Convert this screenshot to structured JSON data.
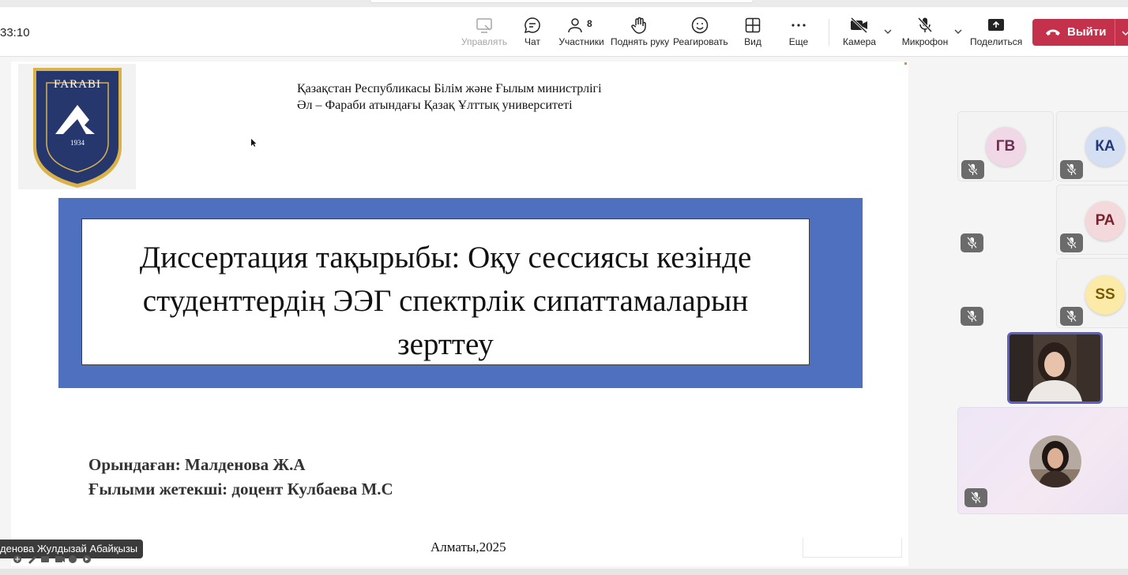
{
  "meeting": {
    "timer": "33:10",
    "participants_count": "8"
  },
  "toolbar": {
    "manage": "Управлять",
    "chat": "Чат",
    "participants": "Участники",
    "raise_hand": "Поднять руку",
    "react": "Реагировать",
    "view": "Вид",
    "more": "Еще",
    "camera": "Камера",
    "microphone": "Микрофон",
    "share": "Поделиться",
    "leave": "Выйти"
  },
  "slide": {
    "logo_text": "FARABI",
    "logo_year": "1934",
    "institution_line1": "Қазақстан Республикасы Білім және Ғылым министрлігі",
    "institution_line2": "Әл – Фараби атындағы Қазақ Ұлттық университеті",
    "title_line1": "Диссертация тақырыбы: Оқу сессиясы кезінде",
    "title_line2": "студенттердің ЭЭГ спектрлік сипаттамаларын",
    "title_line3": "зерттеу",
    "author_line1": "Орындаған: Малденова Ж.А",
    "author_line2": "Ғылыми жетекші: доцент Кулбаева М.С",
    "city_year": "Алматы,2025"
  },
  "presenter": {
    "name": "денова Жулдызай Абайқызы"
  },
  "participants": [
    {
      "initials": "ГВ",
      "bg": "#f0d8e6",
      "fg": "#6b2f52"
    },
    {
      "initials": "КА",
      "bg": "#d4dff3",
      "fg": "#223a78"
    },
    {
      "initials": "РА",
      "bg": "#f3d9dc",
      "fg": "#7a2230"
    },
    {
      "initials": "SS",
      "bg": "#fbeaa8",
      "fg": "#7a5a00"
    }
  ],
  "colors": {
    "leave": "#c4314b",
    "slide_frame": "#4f70be",
    "active_speaker": "#5b5fc7"
  }
}
